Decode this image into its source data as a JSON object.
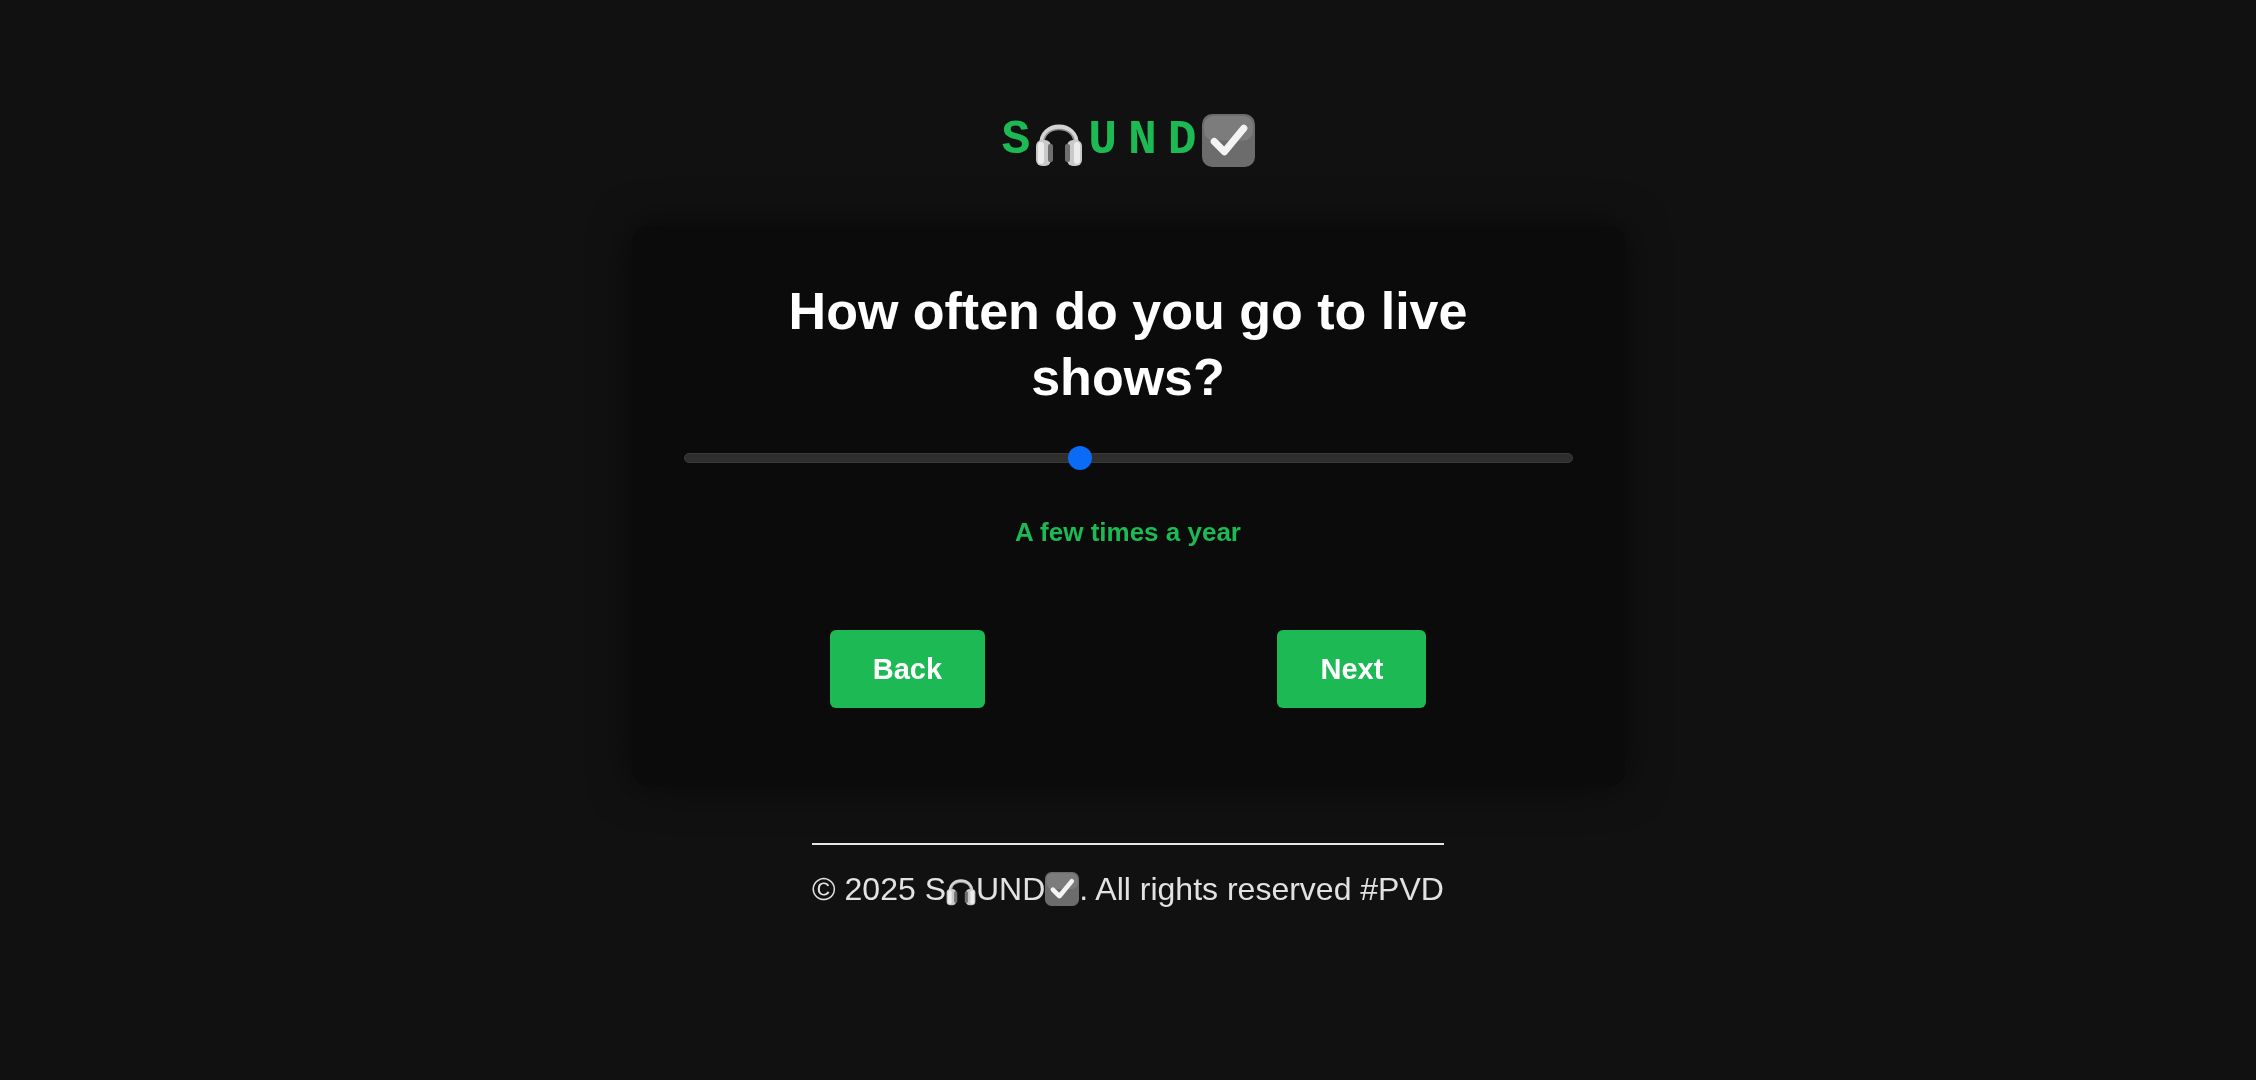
{
  "logo": [
    {
      "kind": "text",
      "text": "S"
    },
    {
      "kind": "headphones"
    },
    {
      "kind": "text",
      "text": "UND"
    },
    {
      "kind": "checkbox"
    }
  ],
  "question": {
    "title": "How often do you go to live shows?",
    "slider": {
      "level": 0.444
    },
    "answer": "A few times a year"
  },
  "buttons": [
    {
      "label": "Back"
    },
    {
      "label": "Next"
    }
  ],
  "footer": {
    "parts": [
      {
        "kind": "text",
        "text": "© 2025 S"
      },
      {
        "kind": "headphones"
      },
      {
        "kind": "text",
        "text": "UND"
      },
      {
        "kind": "checkbox"
      },
      {
        "kind": "text",
        "text": ". All rights reserved #PVD"
      }
    ]
  }
}
